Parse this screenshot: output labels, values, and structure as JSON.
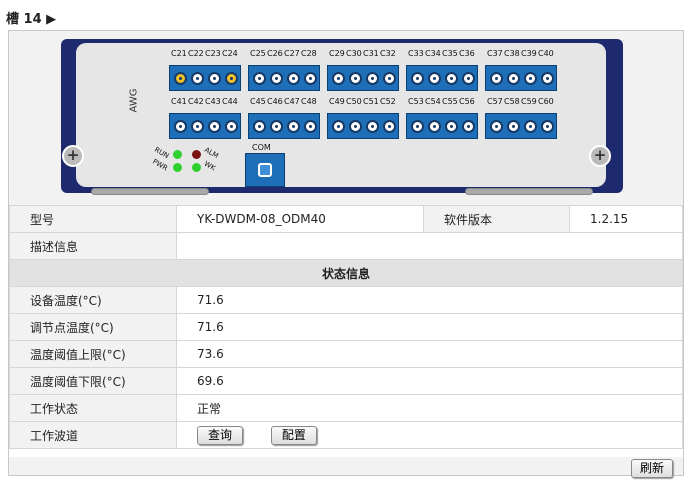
{
  "header": {
    "title": "槽 14 ▶"
  },
  "panel": {
    "awg_label": "AWG",
    "row1_ports": [
      "C21",
      "C22",
      "C23",
      "C24",
      "C25",
      "C26",
      "C27",
      "C28",
      "C29",
      "C30",
      "C31",
      "C32",
      "C33",
      "C34",
      "C35",
      "C36",
      "C37",
      "C38",
      "C39",
      "C40"
    ],
    "row2_ports": [
      "C41",
      "C42",
      "C43",
      "C44",
      "C45",
      "C46",
      "C47",
      "C48",
      "C49",
      "C50",
      "C51",
      "C52",
      "C53",
      "C54",
      "C55",
      "C56",
      "C57",
      "C58",
      "C59",
      "C60"
    ],
    "leds": {
      "run": "RUN",
      "pwr": "PWR",
      "alm": "ALM",
      "wk": "WK"
    },
    "com_label": "COM",
    "colors": {
      "run": "#2ed02e",
      "pwr": "#2ed02e",
      "alm": "#7a1010",
      "wk": "#2ed02e"
    }
  },
  "info": {
    "model_label": "型号",
    "model_value": "YK-DWDM-08_ODM40",
    "sw_label": "软件版本",
    "sw_value": "1.2.15",
    "desc_label": "描述信息",
    "desc_value": ""
  },
  "status": {
    "section_title": "状态信息",
    "rows": [
      {
        "label": "设备温度(°C)",
        "value": "71.6"
      },
      {
        "label": "调节点温度(°C)",
        "value": "71.6"
      },
      {
        "label": "温度阈值上限(°C)",
        "value": "73.6"
      },
      {
        "label": "温度阈值下限(°C)",
        "value": "69.6"
      },
      {
        "label": "工作状态",
        "value": "正常"
      }
    ],
    "channel_label": "工作波道",
    "query_button": "查询",
    "config_button": "配置"
  },
  "footer": {
    "refresh_button": "刷新"
  }
}
